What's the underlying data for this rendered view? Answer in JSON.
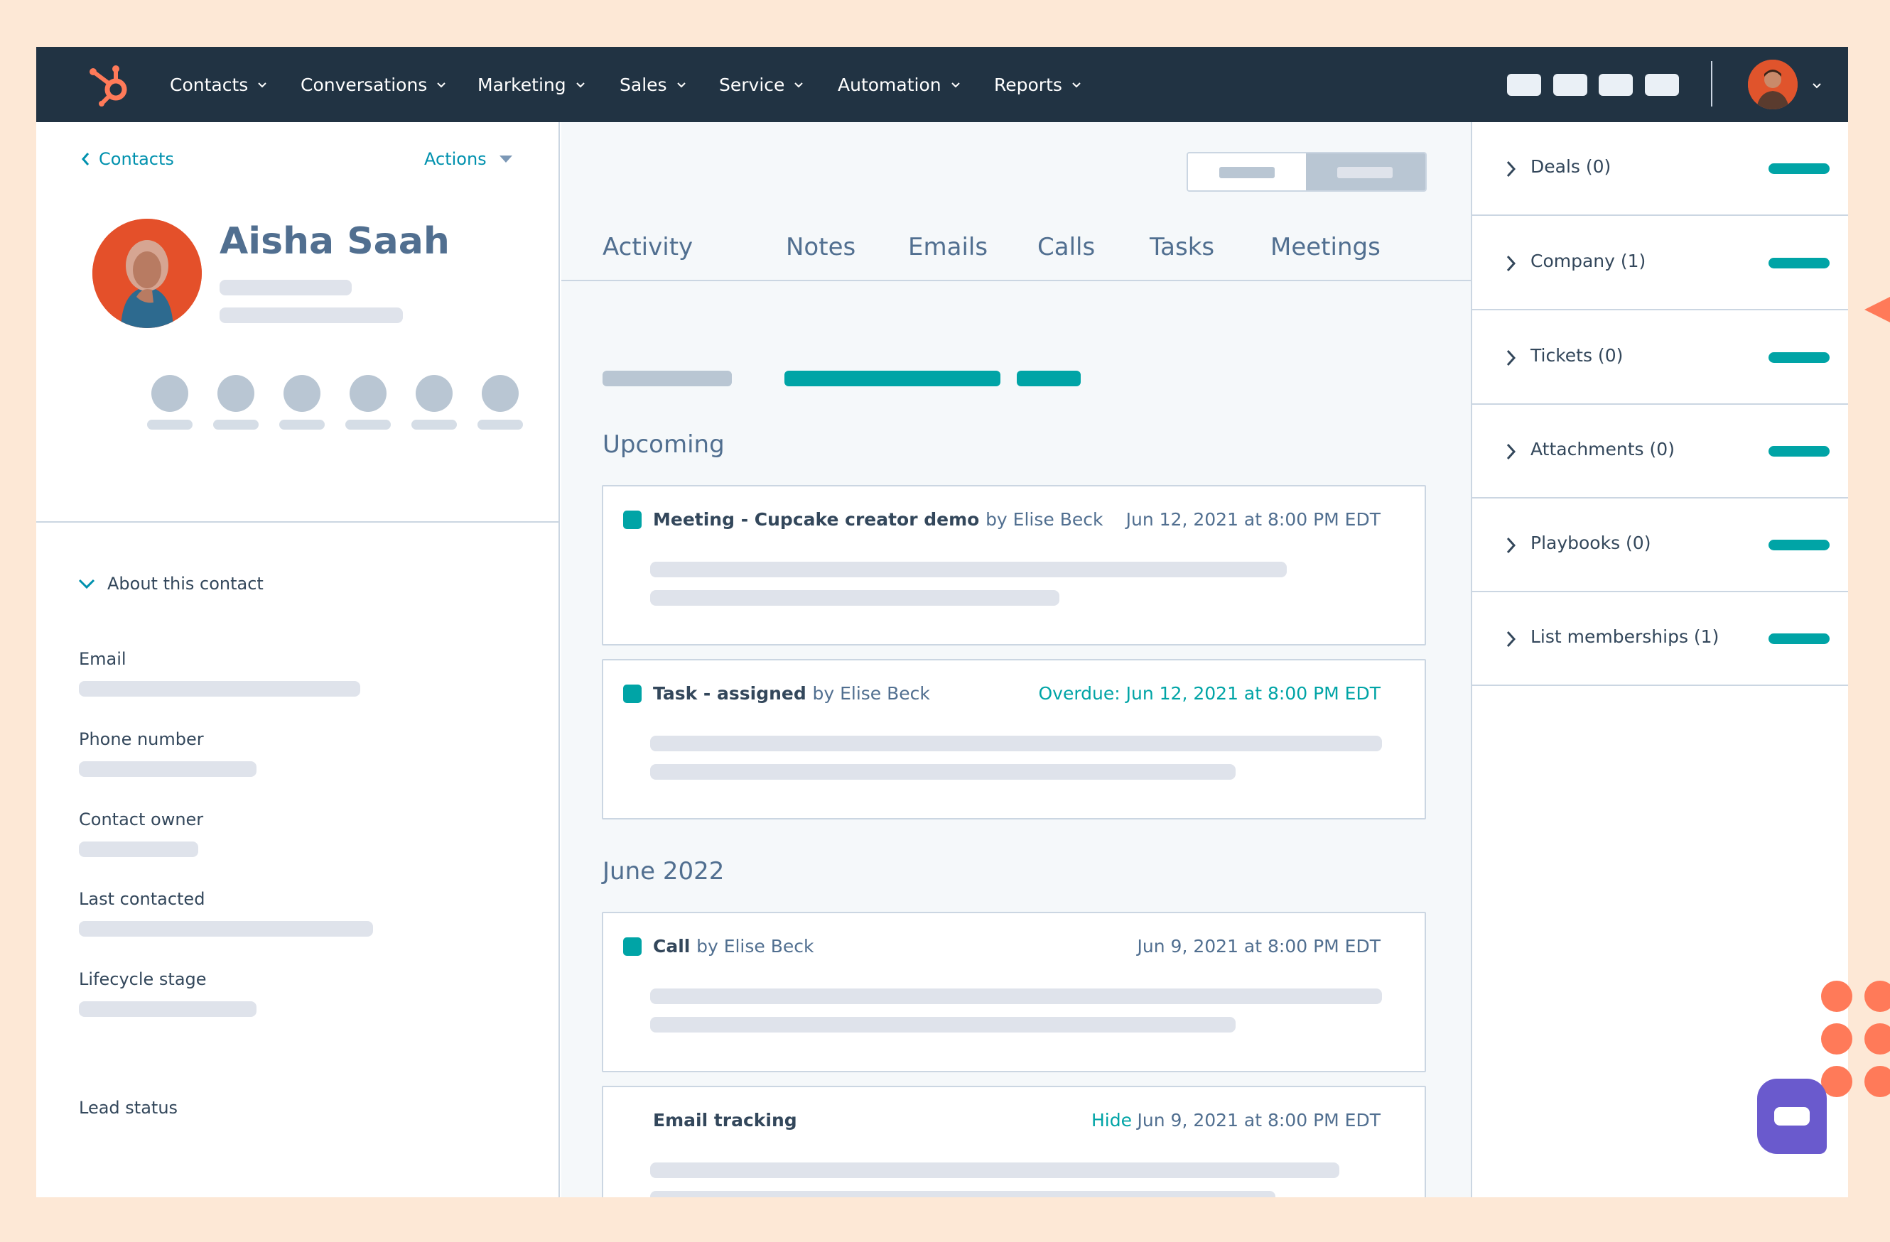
{
  "nav": {
    "items": [
      "Contacts",
      "Conversations",
      "Marketing",
      "Sales",
      "Service",
      "Automation",
      "Reports"
    ]
  },
  "left": {
    "back_label": "Contacts",
    "actions_label": "Actions",
    "contact_name": "Aisha Saah",
    "about_label": "About this contact",
    "fields": [
      "Email",
      "Phone number",
      "Contact owner",
      "Last contacted",
      "Lifecycle stage",
      "Lead status"
    ]
  },
  "middle": {
    "tabs": [
      "Activity",
      "Notes",
      "Emails",
      "Calls",
      "Tasks",
      "Meetings"
    ],
    "sections": {
      "upcoming": "Upcoming",
      "june": "June 2022"
    },
    "cards": [
      {
        "title": "Meeting - Cupcake creator demo",
        "by": "by Elise Beck",
        "date": "Jun 12, 2021 at 8:00 PM EDT"
      },
      {
        "title": "Task - assigned",
        "by": "by Elise Beck",
        "date": "Overdue: Jun 12, 2021 at 8:00 PM EDT"
      },
      {
        "title": "Call",
        "by": "by Elise Beck",
        "date": "Jun 9, 2021 at 8:00 PM EDT"
      },
      {
        "title": "Email tracking",
        "hide": "Hide",
        "date": "Jun 9, 2021 at 8:00 PM EDT"
      }
    ]
  },
  "right": {
    "associations": [
      "Deals (0)",
      "Company (1)",
      "Tickets (0)",
      "Attachments (0)",
      "Playbooks (0)",
      "List memberships (1)"
    ]
  },
  "colors": {
    "nav_bg": "#213343",
    "accent_teal": "#00a4a6",
    "link_blue": "#0091ae",
    "brand_orange": "#ff7a59",
    "chat_purple": "#6a5acd"
  }
}
